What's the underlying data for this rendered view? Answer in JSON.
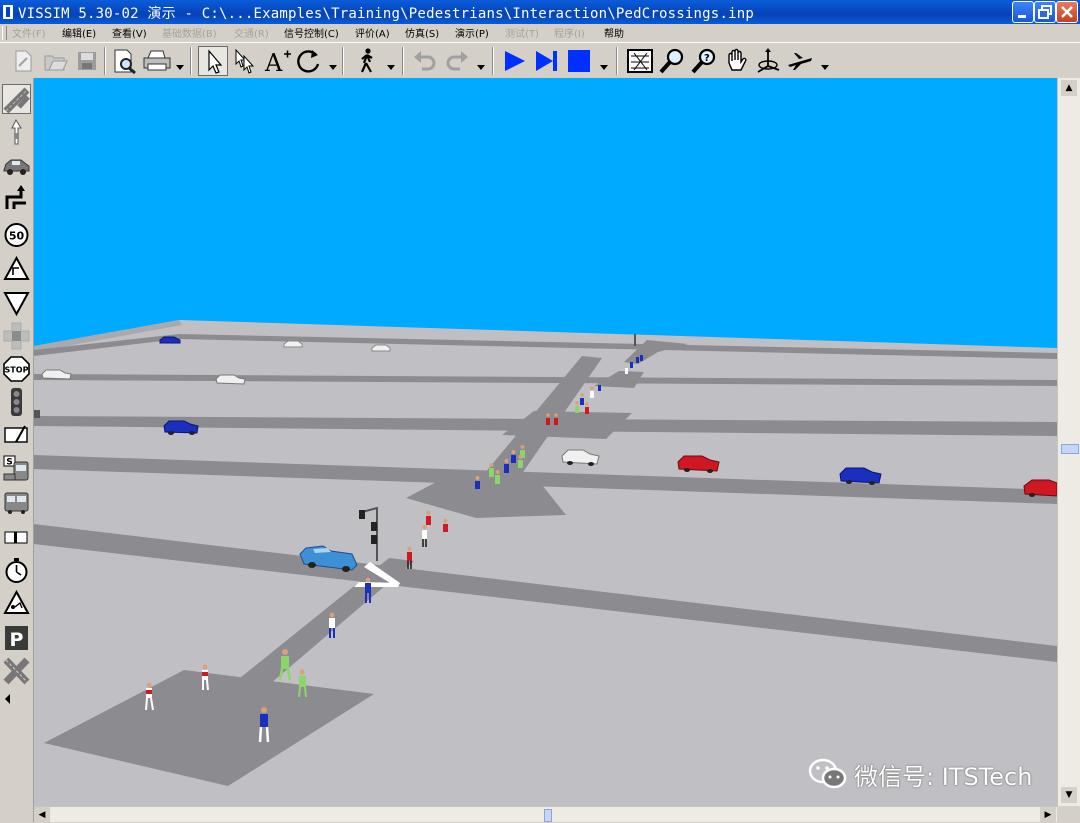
{
  "window": {
    "title": "VISSIM 5.30-02 演示 - C:\\...Examples\\Training\\Pedestrians\\Interaction\\PedCrossings.inp",
    "controls": [
      "minimize",
      "maximize",
      "close"
    ]
  },
  "menu": [
    {
      "label": "文件(F)",
      "enabled": false
    },
    {
      "label": "编辑(E)",
      "enabled": true
    },
    {
      "label": "查看(V)",
      "enabled": true
    },
    {
      "label": "基础数据(B)",
      "enabled": false
    },
    {
      "label": "交通(R)",
      "enabled": false
    },
    {
      "label": "信号控制(C)",
      "enabled": true
    },
    {
      "label": "评价(A)",
      "enabled": true
    },
    {
      "label": "仿真(S)",
      "enabled": true
    },
    {
      "label": "演示(P)",
      "enabled": true
    },
    {
      "label": "测试(T)",
      "enabled": false
    },
    {
      "label": "程序(I)",
      "enabled": false
    },
    {
      "label": "帮助",
      "enabled": true
    }
  ],
  "toolbar": [
    {
      "name": "new-file-icon",
      "enabled": false
    },
    {
      "name": "open-file-icon",
      "enabled": false
    },
    {
      "name": "save-icon",
      "enabled": false
    },
    {
      "name": "print-preview-icon",
      "enabled": true
    },
    {
      "name": "print-icon",
      "enabled": true,
      "dropdown": true
    },
    {
      "name": "select-pointer-icon",
      "enabled": true,
      "pressed": true
    },
    {
      "name": "multi-select-icon",
      "enabled": true
    },
    {
      "name": "text-label-icon",
      "enabled": true
    },
    {
      "name": "rotate-icon",
      "enabled": true,
      "dropdown": true
    },
    {
      "name": "pedestrian-icon",
      "enabled": true,
      "dropdown": true
    },
    {
      "name": "undo-icon",
      "enabled": false
    },
    {
      "name": "redo-icon",
      "enabled": false,
      "dropdown": true
    },
    {
      "name": "play-icon",
      "enabled": true
    },
    {
      "name": "step-forward-icon",
      "enabled": true
    },
    {
      "name": "stop-icon",
      "enabled": true,
      "dropdown": true
    },
    {
      "name": "zoom-extent-icon",
      "enabled": true
    },
    {
      "name": "zoom-in-icon",
      "enabled": true
    },
    {
      "name": "zoom-help-icon",
      "enabled": true
    },
    {
      "name": "pan-hand-icon",
      "enabled": true
    },
    {
      "name": "rotate-3d-icon",
      "enabled": true
    },
    {
      "name": "fly-mode-icon",
      "enabled": true,
      "dropdown": true
    }
  ],
  "side_toolbar": [
    {
      "name": "links-icon",
      "pressed": true
    },
    {
      "name": "vehicle-input-icon"
    },
    {
      "name": "vehicle-type-icon"
    },
    {
      "name": "routing-icon"
    },
    {
      "name": "speed-limit-icon",
      "text": "50"
    },
    {
      "name": "reduced-speed-icon"
    },
    {
      "name": "yield-icon"
    },
    {
      "name": "conflict-area-icon"
    },
    {
      "name": "stop-sign-icon",
      "text": "STOP"
    },
    {
      "name": "signal-head-icon"
    },
    {
      "name": "detector-icon"
    },
    {
      "name": "transit-stop-icon",
      "text": "S"
    },
    {
      "name": "transit-line-icon"
    },
    {
      "name": "queue-counter-icon"
    },
    {
      "name": "travel-time-icon"
    },
    {
      "name": "warning-icon"
    },
    {
      "name": "parking-icon",
      "text": "P"
    },
    {
      "name": "close-links-icon"
    }
  ],
  "scene": {
    "sky_color": "#00aaff",
    "ground_color": "#c0c0c4",
    "road_color": "#8c8c90",
    "crossing_color": "#ffffff",
    "vehicle_colors": {
      "blue": "#1a2fc0",
      "red": "#d01822",
      "white": "#f0f0f0",
      "light-blue": "#3d8fd6"
    },
    "pedestrian_colors": {
      "blue": "#1a2fc0",
      "red": "#d01822",
      "green": "#8ad66a",
      "white": "#ffffff"
    }
  },
  "watermark": {
    "text": "微信号: ITSTech"
  }
}
